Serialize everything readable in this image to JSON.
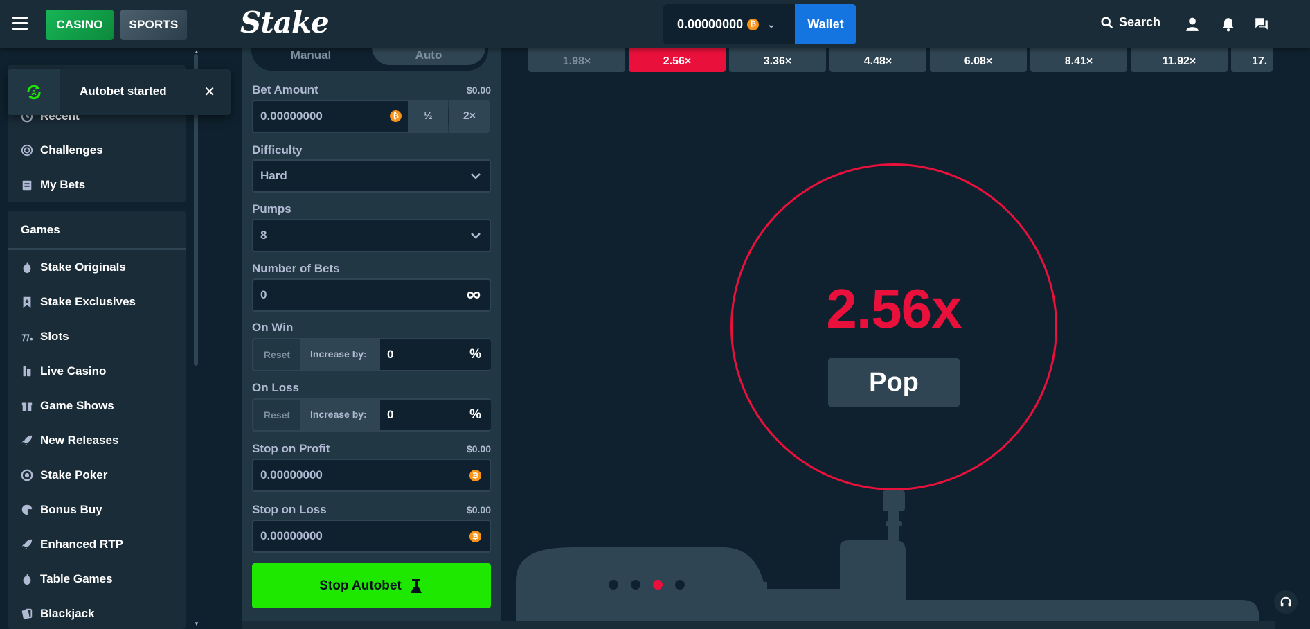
{
  "header": {
    "casino_label": "CASINO",
    "sports_label": "SPORTS",
    "logo_text": "Stake",
    "balance": "0.00000000",
    "currency_icon": "bitcoin-icon",
    "wallet_label": "Wallet",
    "search_label": "Search"
  },
  "toast": {
    "message": "Autobet started"
  },
  "sidebar": {
    "top_items": [
      {
        "label": "Recent",
        "icon": "clock-icon"
      },
      {
        "label": "Challenges",
        "icon": "challenges-icon"
      },
      {
        "label": "My Bets",
        "icon": "my-bets-icon"
      }
    ],
    "games_title": "Games",
    "game_items": [
      {
        "label": "Stake Originals",
        "icon": "fire-icon"
      },
      {
        "label": "Stake Exclusives",
        "icon": "bookmark-star-icon"
      },
      {
        "label": "Slots",
        "icon": "slots-icon"
      },
      {
        "label": "Live Casino",
        "icon": "live-casino-icon"
      },
      {
        "label": "Game Shows",
        "icon": "gift-icon"
      },
      {
        "label": "New Releases",
        "icon": "rocket-icon"
      },
      {
        "label": "Stake Poker",
        "icon": "poker-chip-icon"
      },
      {
        "label": "Bonus Buy",
        "icon": "bonus-buy-icon"
      },
      {
        "label": "Enhanced RTP",
        "icon": "rocket-icon"
      },
      {
        "label": "Table Games",
        "icon": "fire-icon"
      },
      {
        "label": "Blackjack",
        "icon": "cards-icon"
      }
    ]
  },
  "panel": {
    "tab_manual": "Manual",
    "tab_auto": "Auto",
    "bet_amount_label": "Bet Amount",
    "bet_amount_usd": "$0.00",
    "bet_amount_value": "0.00000000",
    "half_label": "½",
    "double_label": "2×",
    "difficulty_label": "Difficulty",
    "difficulty_value": "Hard",
    "pumps_label": "Pumps",
    "pumps_value": "8",
    "num_bets_label": "Number of Bets",
    "num_bets_value": "0",
    "on_win_label": "On Win",
    "on_loss_label": "On Loss",
    "reset_label": "Reset",
    "increase_label": "Increase by:",
    "on_win_value": "0",
    "on_loss_value": "0",
    "percent_symbol": "%",
    "stop_profit_label": "Stop on Profit",
    "stop_profit_usd": "$0.00",
    "stop_profit_value": "0.00000000",
    "stop_loss_label": "Stop on Loss",
    "stop_loss_usd": "$0.00",
    "stop_loss_value": "0.00000000",
    "stop_autobet_label": "Stop Autobet"
  },
  "game": {
    "history": [
      "1.98×",
      "2.56×",
      "3.36×",
      "4.48×",
      "6.08×",
      "8.41×",
      "11.92×",
      "17."
    ],
    "active_history_index": 1,
    "multiplier": "2.56x",
    "pop_label": "Pop",
    "pager_dots": 4,
    "pager_active": 2
  },
  "colors": {
    "accent_red": "#e9113c",
    "accent_green": "#1fe800",
    "wallet_blue": "#1475e1"
  }
}
